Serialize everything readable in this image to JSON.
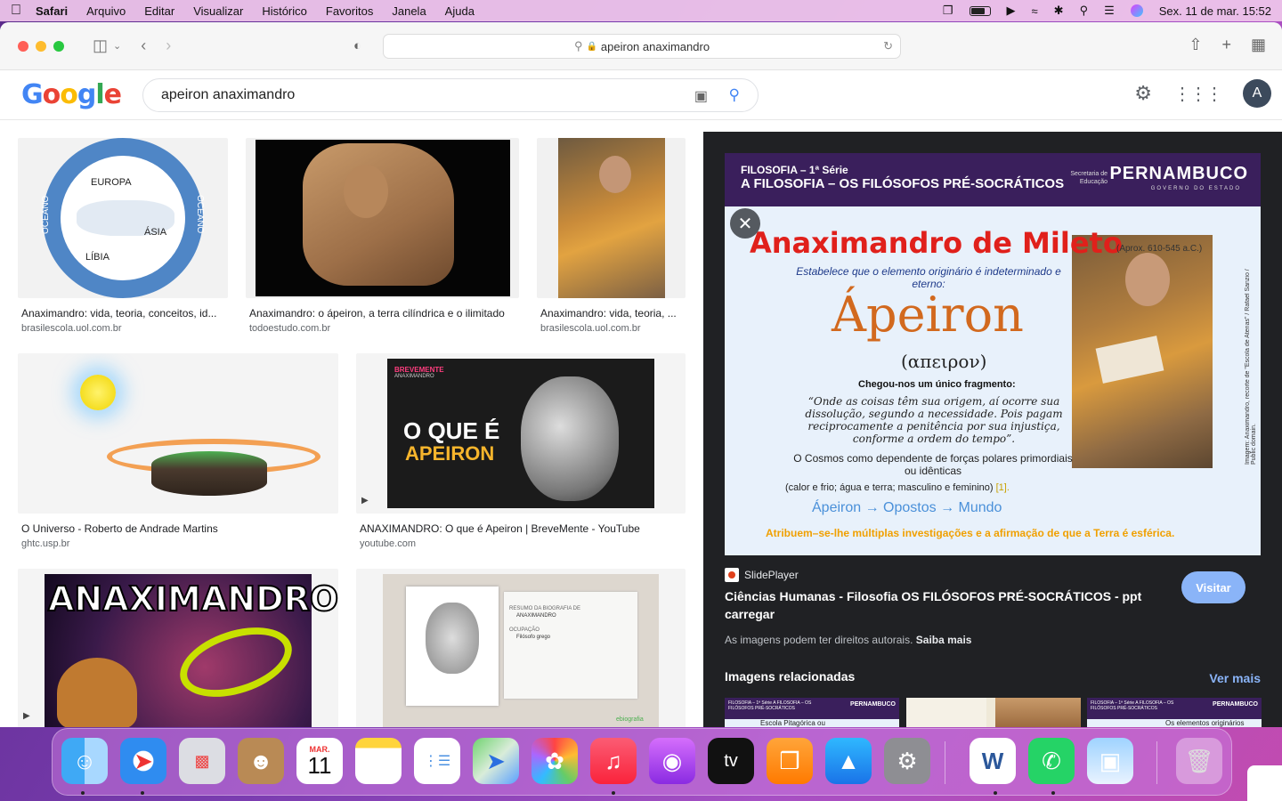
{
  "menubar": {
    "apple": "",
    "items": [
      "Safari",
      "Arquivo",
      "Editar",
      "Visualizar",
      "Histórico",
      "Favoritos",
      "Janela",
      "Ajuda"
    ],
    "datetime": "Sex. 11 de mar.  15:52"
  },
  "safari": {
    "url": "apeiron anaximandro",
    "lock": "🔒"
  },
  "google": {
    "logo": [
      "G",
      "o",
      "o",
      "g",
      "l",
      "e"
    ],
    "query": "apeiron anaximandro",
    "avatar": "A"
  },
  "results": [
    {
      "caption": "Anaximandro: vida, teoria, conceitos, id...",
      "source": "brasilescola.uol.com.br",
      "labels": [
        "EUROPA",
        "ÁSIA",
        "LÍBIA",
        "OCEANO",
        "OCEANO"
      ]
    },
    {
      "caption": "Anaximandro: o ápeiron, a terra cilíndrica e o ilimitado",
      "source": "todoestudo.com.br"
    },
    {
      "caption": "Anaximandro: vida, teoria, ...",
      "source": "brasilescola.uol.com.br"
    },
    {
      "caption": "O Universo - Roberto de Andrade Martins",
      "source": "ghtc.usp.br"
    },
    {
      "caption": "ANAXIMANDRO: O que é Apeiron | BreveMente - YouTube",
      "source": "youtube.com",
      "thumb_top": "BREVEMENTE",
      "thumb_sub": "ANAXIMANDRO",
      "thumb_l1": "O QUE É",
      "thumb_l2": "APEIRON"
    },
    {
      "thumb_title": "ANAXIMANDRO"
    },
    {
      "thumb_l1": "RESUMO DA BIOGRAFIA DE",
      "thumb_l2": "ANAXIMANDRO",
      "thumb_l3": "OCUPAÇÃO",
      "thumb_l4": "Filósofo grego",
      "thumb_brand": "ebiografia"
    }
  ],
  "preview": {
    "slide": {
      "header_l1": "FILOSOFIA – 1ª Série",
      "header_l2": "A FILOSOFIA – OS FILÓSOFOS PRÉ-SOCRÁTICOS",
      "secretaria": "Secretaria de Educação",
      "brand": "PERNAMBUCO",
      "brand_sub": "GOVERNO DO ESTADO",
      "title": "Anaximandro de Mileto",
      "approx": "(Aprox. 610-545 a.C.)",
      "establishes": "Estabelece que o elemento originário é indeterminado e eterno:",
      "apeiron": "Ápeiron",
      "greek": "(απειρον)",
      "fragment": "Chegou-nos um único fragmento:",
      "quote": "“Onde as coisas têm sua origem, aí ocorre sua dissolução, segundo a necessidade. Pois pagam reciprocamente a penitência por sua injustiça, conforme a ordem do tempo”.",
      "cosmos": "O Cosmos como dependente de forças polares primordiais ou idênticas",
      "pairs": "(calor e frio; água e terra; masculino e feminino)",
      "ref": "[1].",
      "arrows": "Ápeiron → Opostos  → Mundo",
      "bottom": "Atribuem–se-lhe múltiplas investigações e a afirmação de que a Terra é esférica.",
      "credit": "Imagem: Anaximandro, recorte de \"Escola de Atenas\" / Rafael Sanzio / Public domain."
    },
    "source": "SlidePlayer",
    "title": "Ciências Humanas - Filosofia OS FILÓSOFOS PRÉ-SOCRÁTICOS - ppt carregar",
    "visit": "Visitar",
    "rights": "As imagens podem ter direitos autorais.",
    "rights_link": "Saiba mais",
    "related": "Imagens relacionadas",
    "more": "Ver mais",
    "related_items": [
      {
        "header": "FILOSOFIA – 1ª Série A FILOSOFIA – OS FILÓSOFOS PRÉ-SOCRÁTICOS",
        "brand": "PERNAMBUCO",
        "line": "Escola Pitagórica ou"
      },
      {
        "header": "",
        "brand": "",
        "line": ""
      },
      {
        "header": "FILOSOFIA – 1ª Série A FILOSOFIA – OS FILÓSOFOS PRÉ-SOCRÁTICOS",
        "brand": "PERNAMBUCO",
        "line": "Os elementos originários"
      }
    ]
  },
  "dock": {
    "calendar_month": "MAR.",
    "calendar_day": "11",
    "tv_label": "tv"
  }
}
